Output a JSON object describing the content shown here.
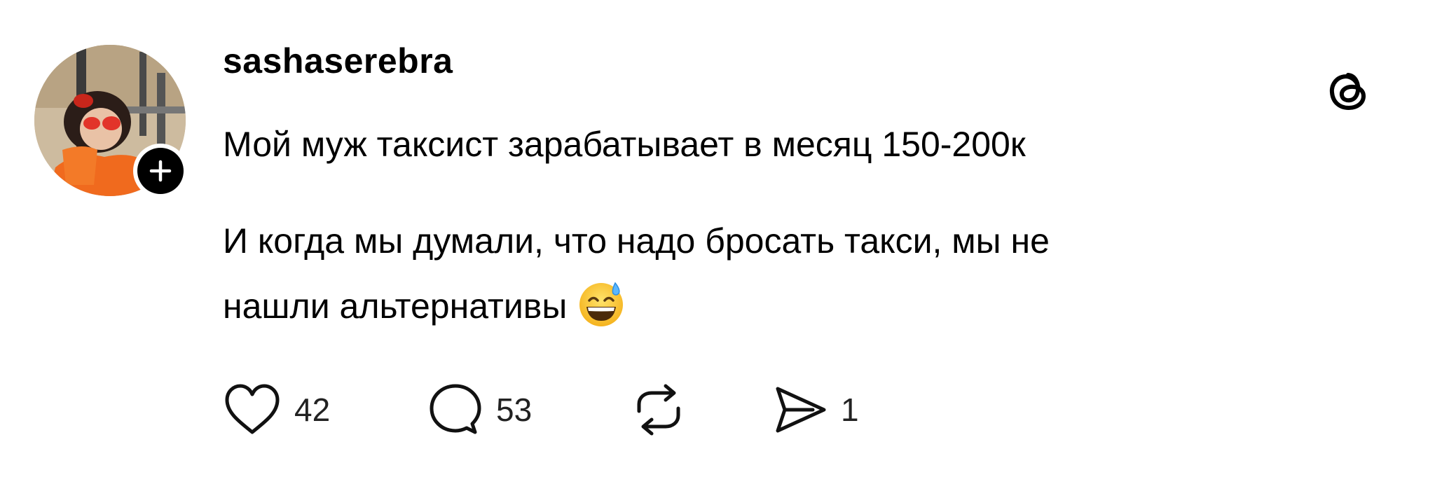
{
  "post": {
    "username": "sashaserebra",
    "text_line1": "Мой муж таксист зарабатывает в месяц 150-200к",
    "text_line2": "И когда мы думали, что надо бросать такси, мы не",
    "text_line3": "нашли альтернативы",
    "emoji_icon": "grinning-face-with-sweat-icon"
  },
  "actions": {
    "likes": "42",
    "replies": "53",
    "shares": "1"
  },
  "icons": {
    "like": "heart-icon",
    "reply": "comment-bubble-icon",
    "repost": "repost-icon",
    "share": "send-icon",
    "brand": "threads-logo-icon",
    "follow": "plus-icon"
  },
  "colors": {
    "text": "#000000",
    "icon": "#111111",
    "background": "#ffffff"
  }
}
